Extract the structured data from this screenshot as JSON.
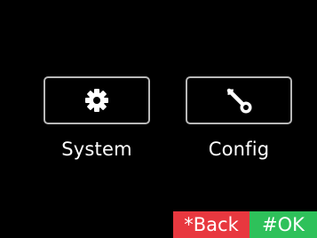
{
  "menu": {
    "items": [
      {
        "label": "System",
        "icon": "gear-icon"
      },
      {
        "label": "Config",
        "icon": "wrench-icon"
      }
    ]
  },
  "softkeys": {
    "back_label": "*Back",
    "ok_label": "#OK",
    "back_color": "#e8383f",
    "ok_color": "#2ec15a"
  },
  "theme": {
    "background": "#000000",
    "tile_border": "#b8b8b8",
    "text": "#ffffff"
  }
}
